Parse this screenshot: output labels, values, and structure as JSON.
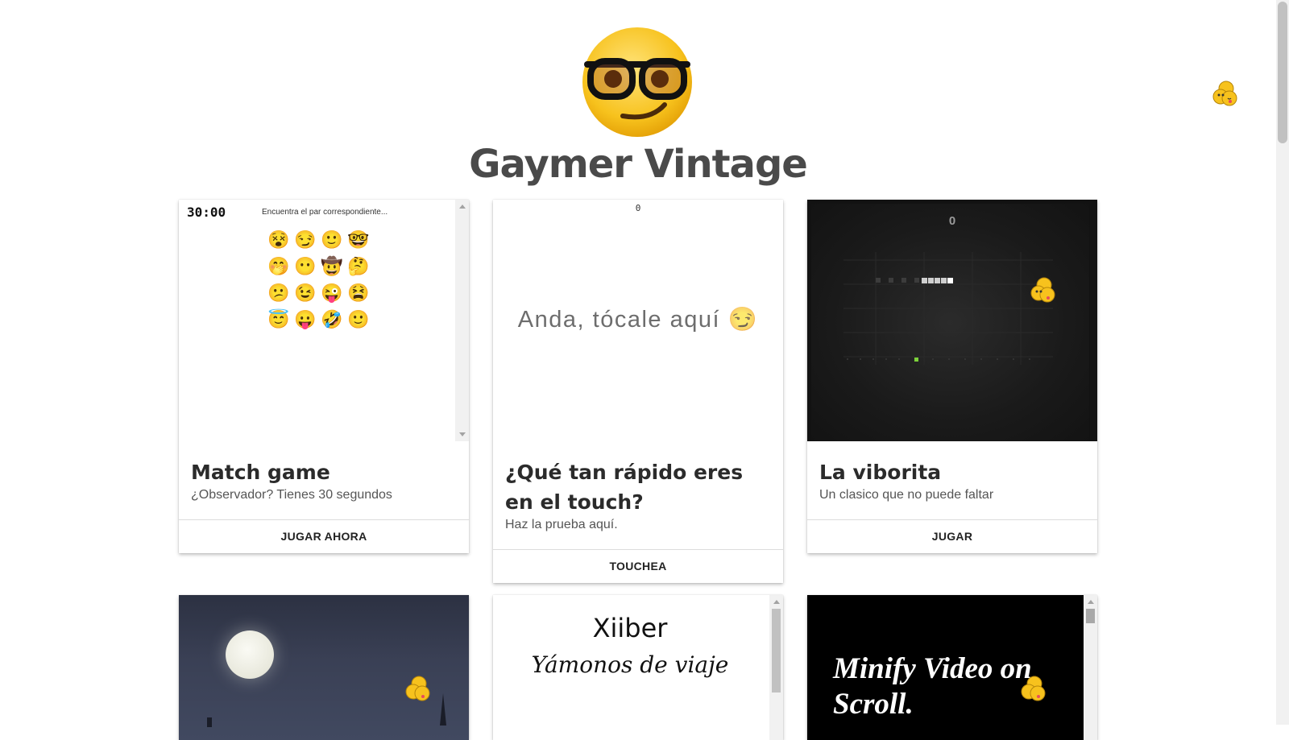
{
  "site": {
    "title": "Gaymer Vintage",
    "logo_icon": "nerd-face-emoji",
    "floating_icon": "flirty-emoji-stack"
  },
  "cards": [
    {
      "title": "Match game",
      "description": "¿Observador? Tienes 30 segundos",
      "action": "JUGAR AHORA",
      "preview": {
        "timer": "30:00",
        "hint": "Encuentra el par correspondiente...",
        "emojis": [
          "😵",
          "😏",
          "🙂",
          "🤓",
          "🤭",
          "😶",
          "🤠",
          "🤔",
          "😕",
          "😉",
          "😜",
          "😫",
          "😇",
          "😛",
          "🤣",
          "🙂"
        ]
      }
    },
    {
      "title": "¿Qué tan rápido eres en el touch?",
      "description": "Haz la prueba aquí.",
      "action": "TOUCHEA",
      "preview": {
        "score": "0",
        "prompt": "Anda, tócale aquí",
        "prompt_emoji": "😏"
      }
    },
    {
      "title": "La viborita",
      "description": "Un clasico que no puede faltar",
      "action": "JUGAR",
      "preview": {
        "score": "0"
      }
    }
  ],
  "row2": {
    "xiiber": {
      "brand": "Xiiber",
      "tagline": "Yámonos de viaje"
    },
    "minify": {
      "line1": "Minify Video on",
      "line2": "Scroll."
    }
  },
  "colors": {
    "title": "#4a4a4a",
    "snake_food": "#7cd13b"
  }
}
